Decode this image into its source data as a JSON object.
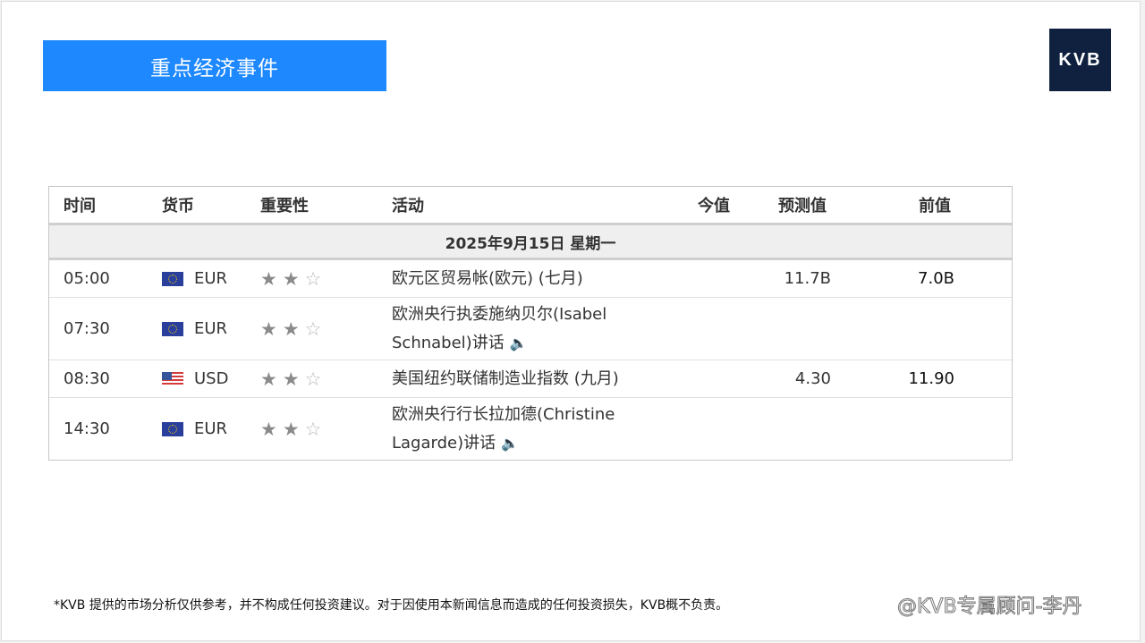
{
  "title": "重点经济事件",
  "logo_text": "KVB",
  "table": {
    "headers": {
      "time": "时间",
      "currency": "货币",
      "importance": "重要性",
      "activity": "活动",
      "actual": "今值",
      "forecast": "预测值",
      "previous": "前值"
    },
    "date_label": "2025年9月15日  星期一",
    "rows": [
      {
        "time": "05:00",
        "flag": "eu-flag-icon",
        "currency": "EUR",
        "stars_filled": 2,
        "stars_total": 3,
        "activity": "欧元区贸易帐(欧元) (七月)",
        "has_speaker": false,
        "actual": "",
        "forecast": "11.7B",
        "previous": "7.0B"
      },
      {
        "time": "07:30",
        "flag": "eu-flag-icon",
        "currency": "EUR",
        "stars_filled": 2,
        "stars_total": 3,
        "activity": "欧洲央行执委施纳贝尔(Isabel Schnabel)讲话",
        "has_speaker": true,
        "actual": "",
        "forecast": "",
        "previous": ""
      },
      {
        "time": "08:30",
        "flag": "us-flag-icon",
        "currency": "USD",
        "stars_filled": 2,
        "stars_total": 3,
        "activity": "美国纽约联储制造业指数 (九月)",
        "has_speaker": false,
        "actual": "",
        "forecast": "4.30",
        "previous": "11.90"
      },
      {
        "time": "14:30",
        "flag": "eu-flag-icon",
        "currency": "EUR",
        "stars_filled": 2,
        "stars_total": 3,
        "activity": "欧洲央行行长拉加德(Christine Lagarde)讲话",
        "has_speaker": true,
        "actual": "",
        "forecast": "",
        "previous": ""
      }
    ]
  },
  "footer_note": "*KVB 提供的市场分析仅供参考，并不构成任何投资建议。对于因使用本新闻信息而造成的任何投资损失，KVB概不负责。",
  "watermark": "@KVB专属顾问-李丹"
}
